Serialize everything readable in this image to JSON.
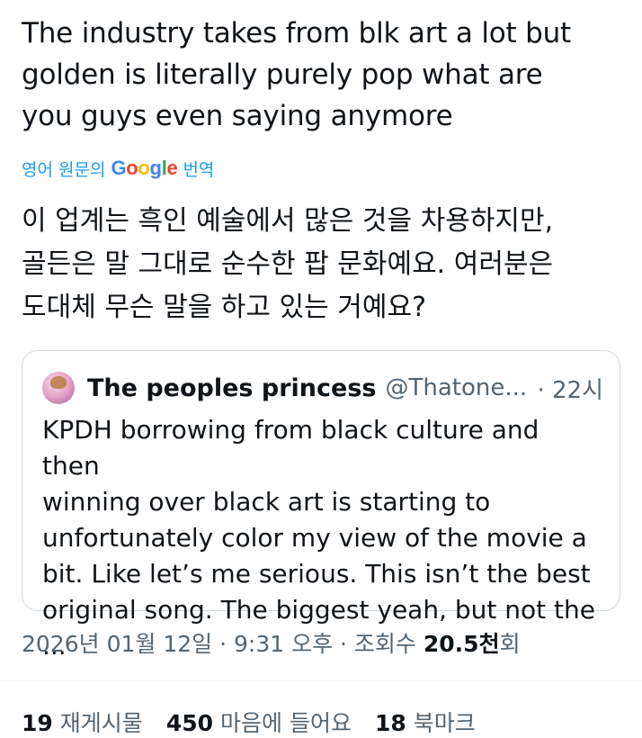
{
  "tweet": {
    "text": "The industry takes from blk art a lot but\ngolden is literally purely pop what are\nyou guys even saying anymore",
    "translate": {
      "prefix": "영어 원문의",
      "google_letters": [
        "G",
        "o",
        "o",
        "g",
        "l",
        "e"
      ],
      "google_colors": [
        "#4285F4",
        "#EA4335",
        "#FBBC05",
        "#4285F4",
        "#34A853",
        "#EA4335"
      ],
      "suffix": "번역"
    },
    "translated_text": "이 업계는 흑인 예술에서 많은 것을 차용하지만,\n골든은 말 그대로 순수한 팝 문화예요. 여러분은\n도대체 무슨 말을 하고 있는 거예요?"
  },
  "quote": {
    "name": "The peoples princess",
    "handle": "@Thatone...",
    "time": "· 22시",
    "body": "KPDH borrowing from black culture and then\nwinning over black art is starting to\nunfortunately color my view of the movie a\nbit. Like let’s me serious. This isn’t the best\noriginal song. The biggest yeah, but not the ..."
  },
  "meta": {
    "date": "2026년 01월 12일",
    "sep1": " · ",
    "time": "9:31 오후",
    "sep2": " · ",
    "views_label": "조회수",
    "views_value": "20.5천",
    "views_suffix": "회"
  },
  "stats": [
    {
      "num": "19",
      "label": "재게시물"
    },
    {
      "num": "450",
      "label": "마음에 들어요"
    },
    {
      "num": "18",
      "label": "북마크"
    }
  ],
  "colors": {
    "link": "#1d9bf0",
    "secondary": "#536471",
    "border": "#cfd9de"
  }
}
